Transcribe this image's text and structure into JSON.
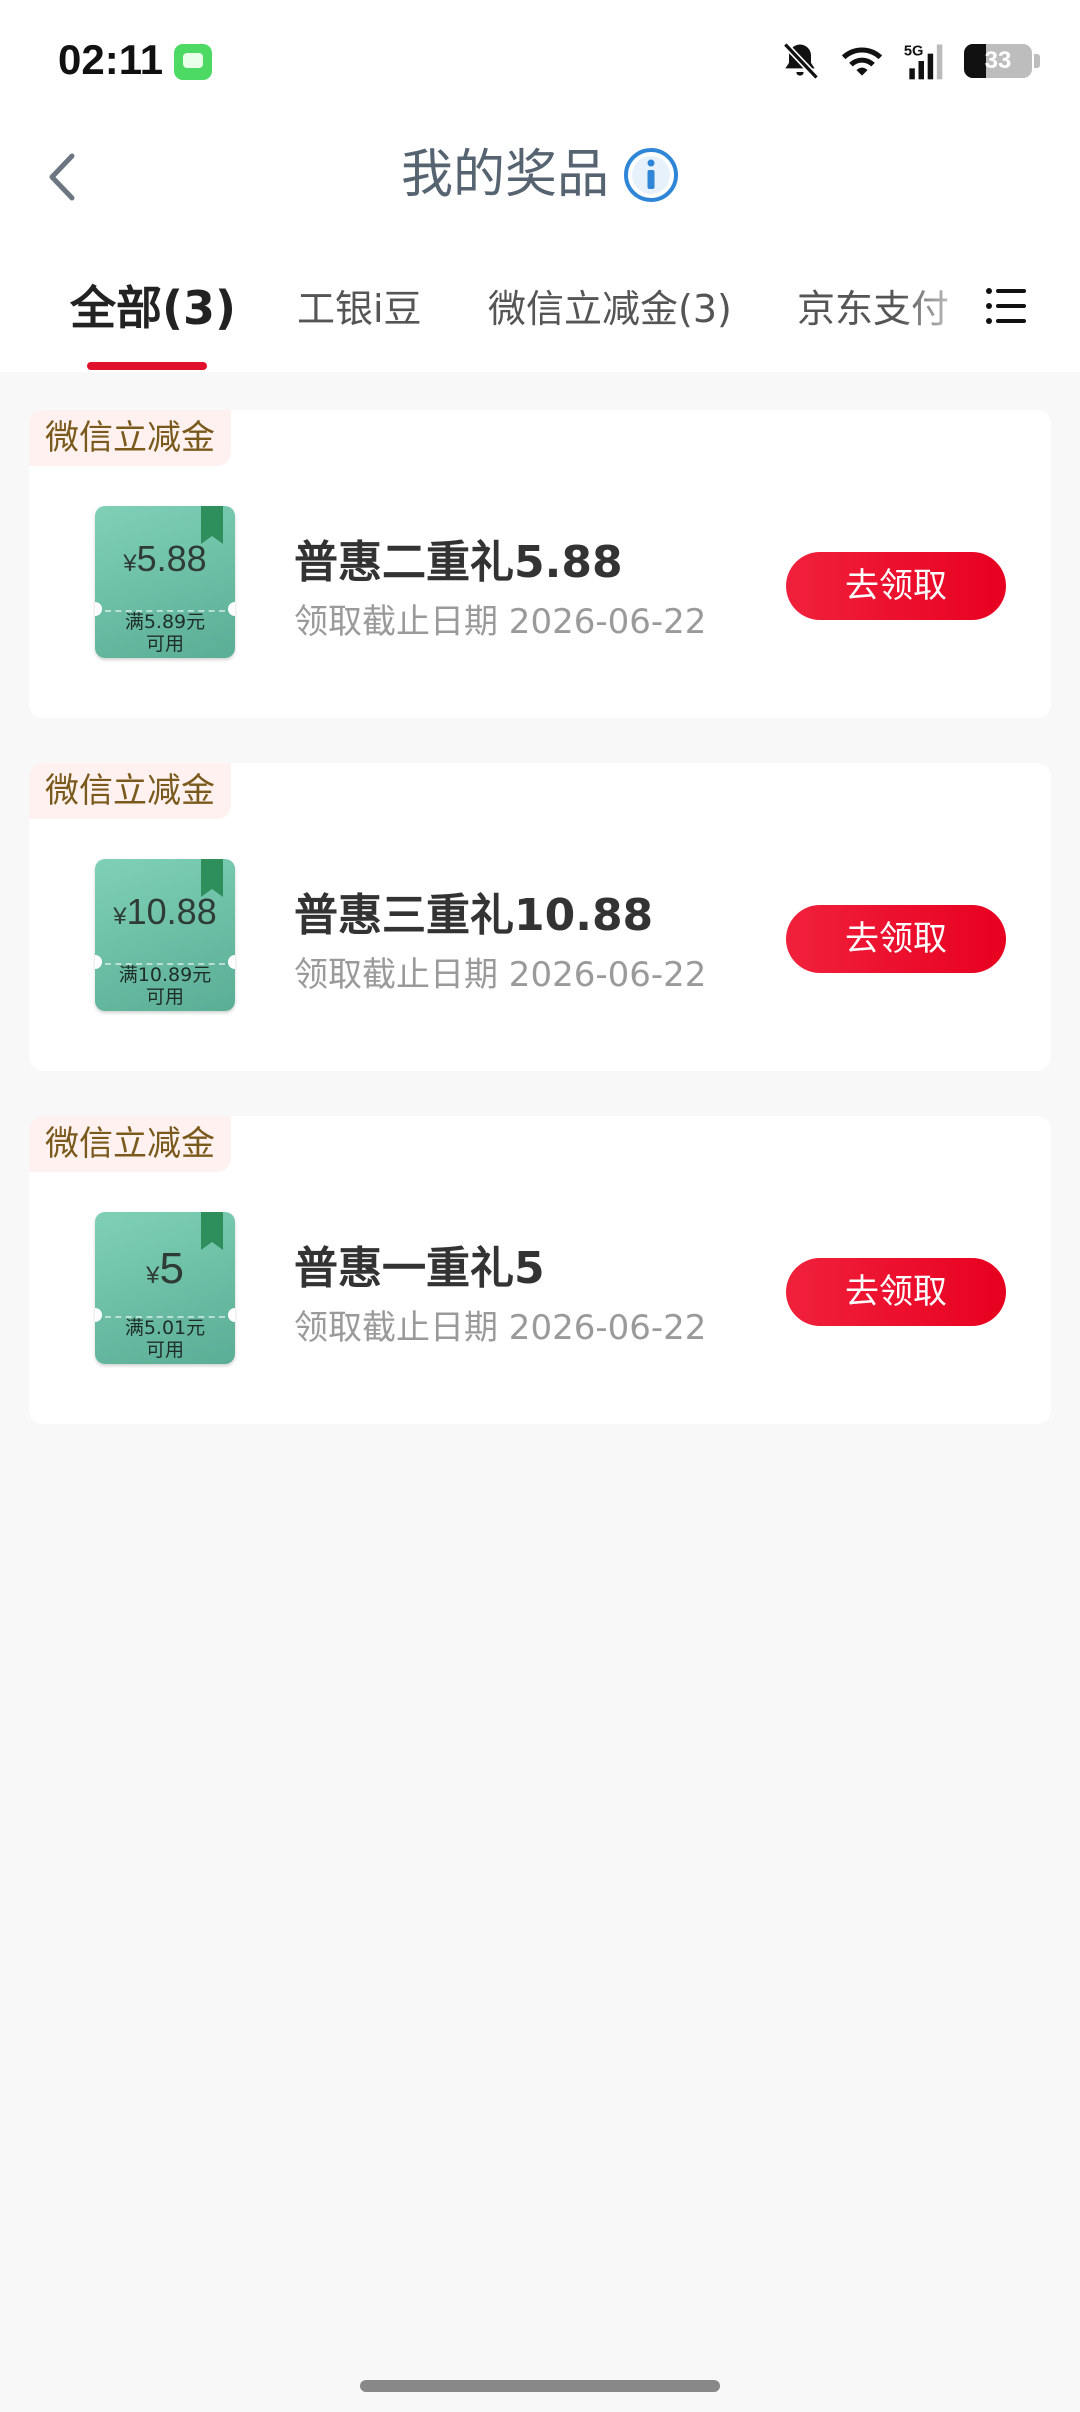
{
  "status_bar": {
    "time": "02:11",
    "network": "5G",
    "battery": "33",
    "battery_fraction": 0.33,
    "icons": [
      "message-app-icon",
      "bell-muted-icon",
      "wifi-icon",
      "signal-icon",
      "battery-icon"
    ]
  },
  "header": {
    "title": "我的奖品",
    "back_icon": "chevron-left-icon",
    "info_icon": "info-icon"
  },
  "tabs": [
    {
      "label": "全部(3)",
      "active": true
    },
    {
      "label": "工银i豆",
      "active": false
    },
    {
      "label": "微信立减金(3)",
      "active": false
    },
    {
      "label": "京东支付",
      "active": false
    }
  ],
  "menu_icon": "list-menu-icon",
  "prizes": [
    {
      "tag": "微信立减金",
      "currency": "¥",
      "amount": "5.88",
      "condition_line1": "满5.89元",
      "condition_line2": "可用",
      "name": "普惠二重礼5.88",
      "deadline": "领取截止日期 2026-06-22",
      "button": "去领取"
    },
    {
      "tag": "微信立减金",
      "currency": "¥",
      "amount": "10.88",
      "condition_line1": "满10.89元",
      "condition_line2": "可用",
      "name": "普惠三重礼10.88",
      "deadline": "领取截止日期 2026-06-22",
      "button": "去领取"
    },
    {
      "tag": "微信立减金",
      "currency": "¥",
      "amount": "5",
      "condition_line1": "满5.01元",
      "condition_line2": "可用",
      "name": "普惠一重礼5",
      "deadline": "领取截止日期 2026-06-22",
      "button": "去领取"
    }
  ],
  "colors": {
    "accent_red": "#e80020",
    "coupon_green": "#6cc0a6",
    "tag_bg": "#fff1ef",
    "tag_text": "#7a5a1c",
    "title_gray": "#566370",
    "info_blue": "#2f86d6"
  }
}
